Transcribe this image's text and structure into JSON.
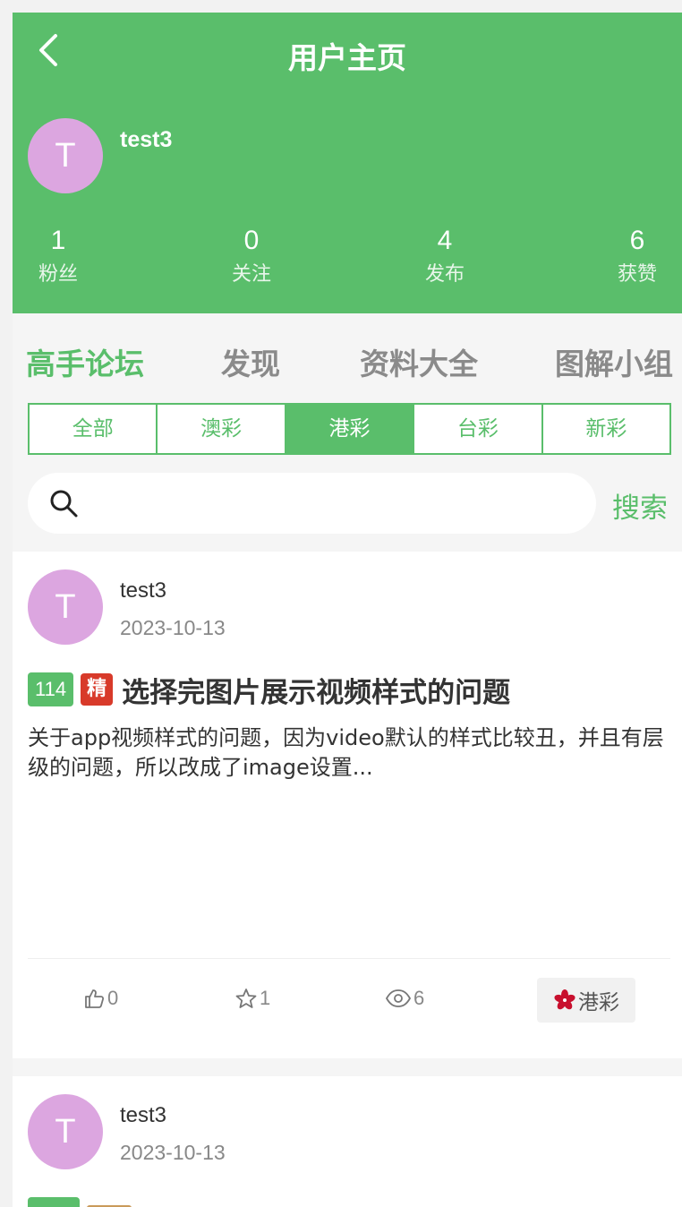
{
  "header": {
    "title": "用户主页",
    "user": {
      "name": "test3",
      "avatar_letter": "T"
    },
    "stats": [
      {
        "value": "1",
        "label": "粉丝"
      },
      {
        "value": "0",
        "label": "关注"
      },
      {
        "value": "4",
        "label": "发布"
      },
      {
        "value": "6",
        "label": "获赞"
      }
    ]
  },
  "tabs": [
    "高手论坛",
    "发现",
    "资料大全",
    "图解小组"
  ],
  "active_tab": "高手论坛",
  "categories": [
    "全部",
    "澳彩",
    "港彩",
    "台彩",
    "新彩"
  ],
  "active_category": "港彩",
  "search": {
    "placeholder": "",
    "button_label": "搜索"
  },
  "posts": [
    {
      "author": "test3",
      "avatar_letter": "T",
      "date": "2023-10-13",
      "number_badge": "114",
      "jing_badge": "精",
      "title": "选择完图片展示视频样式的问题",
      "excerpt": "关于app视频样式的问题，因为video默认的样式比较丑，并且有层级的问题，所以改成了image设置...",
      "likes": "0",
      "favorites": "1",
      "views": "6",
      "category_tag": "港彩"
    },
    {
      "author": "test3",
      "avatar_letter": "T",
      "date": "2023-10-13"
    }
  ],
  "colors": {
    "primary": "#5abe6b",
    "avatar": "#dca6e0",
    "jing_badge": "#d83a2a",
    "hk_flower": "#c8102e"
  }
}
